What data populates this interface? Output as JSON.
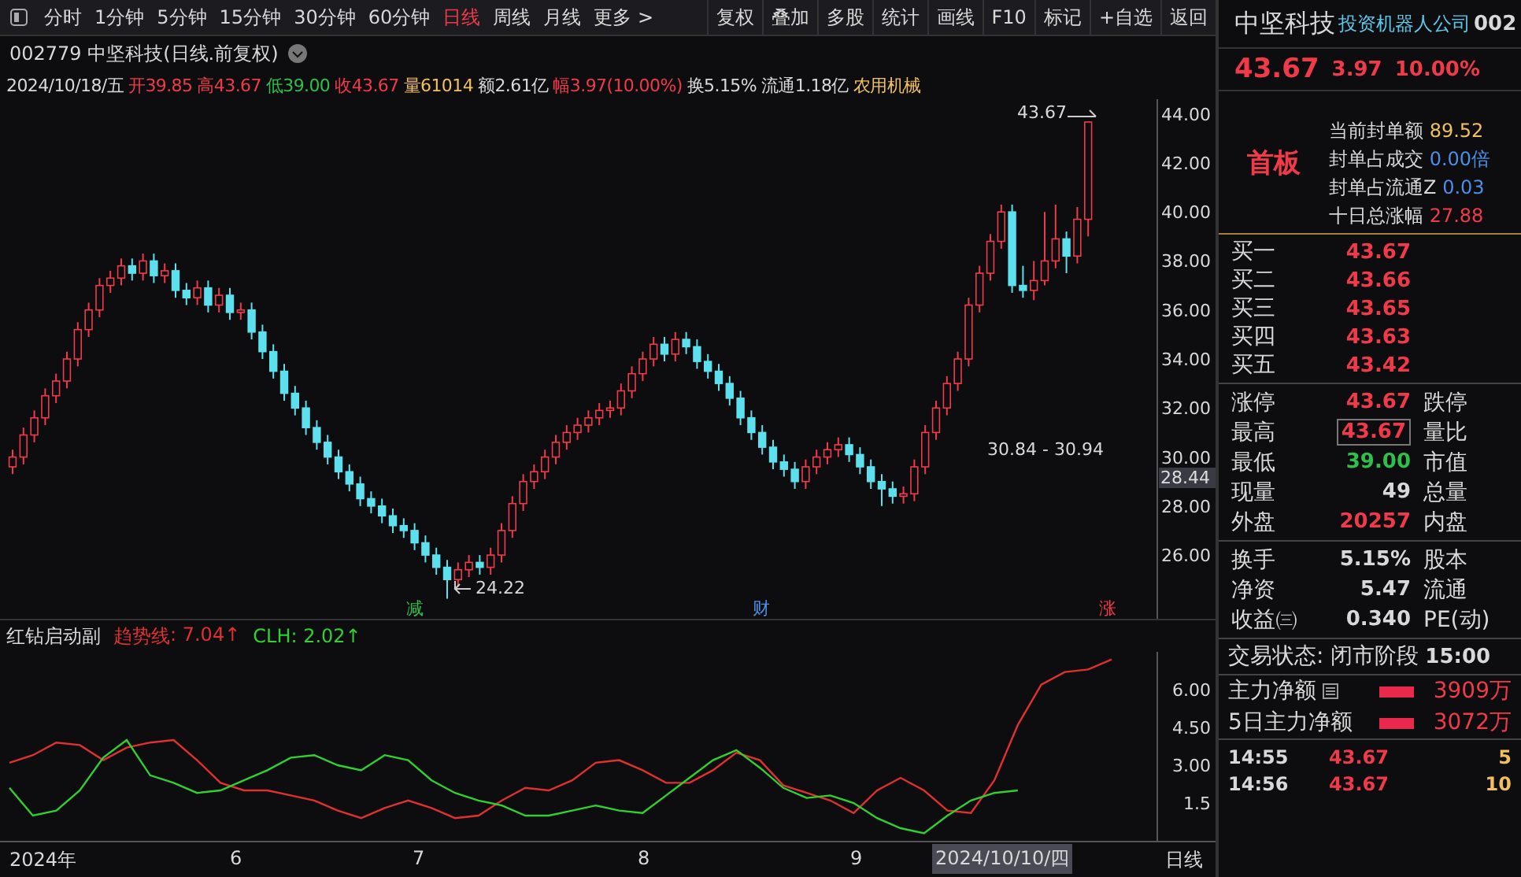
{
  "toolbar": {
    "periods": [
      {
        "label": "分时",
        "selected": false
      },
      {
        "label": "1分钟",
        "selected": false
      },
      {
        "label": "5分钟",
        "selected": false
      },
      {
        "label": "15分钟",
        "selected": false
      },
      {
        "label": "30分钟",
        "selected": false
      },
      {
        "label": "60分钟",
        "selected": false
      },
      {
        "label": "日线",
        "selected": true
      },
      {
        "label": "周线",
        "selected": false
      },
      {
        "label": "月线",
        "selected": false
      }
    ],
    "more": "更多 >",
    "actions": [
      "复权",
      "叠加",
      "多股",
      "统计",
      "画线",
      "F10",
      "标记",
      "+自选",
      "返回"
    ]
  },
  "header": {
    "title": "002779 中坚科技(日线.前复权)"
  },
  "quote_line": [
    {
      "text": "2024/10/18/五",
      "color": "#d8d8d8"
    },
    {
      "text": "开39.85",
      "color": "#f03a4a"
    },
    {
      "text": "高43.67",
      "color": "#f03a4a"
    },
    {
      "text": "低39.00",
      "color": "#2fbf4a"
    },
    {
      "text": "收43.67",
      "color": "#f03a4a"
    },
    {
      "text": "量61014",
      "color": "#f0c060"
    },
    {
      "text": "额2.61亿",
      "color": "#d8d8d8"
    },
    {
      "text": "幅3.97(10.00%)",
      "color": "#f03a4a"
    },
    {
      "text": "换5.15%",
      "color": "#d8d8d8"
    },
    {
      "text": "流通1.18亿",
      "color": "#d8d8d8"
    },
    {
      "text": "农用机械",
      "color": "#f0c060"
    }
  ],
  "chart": {
    "high_label": "43.67",
    "low_label": "24.22",
    "range_label": "30.84 - 30.94",
    "current_price": "28.44",
    "events": [
      {
        "text": "减",
        "color": "#2fbf4a"
      },
      {
        "text": "财",
        "color": "#4a90e8"
      },
      {
        "text": "涨",
        "color": "#f03a4a"
      }
    ],
    "chart_data": {
      "type": "candlestick",
      "ylim": [
        23.4,
        44.6
      ],
      "yticks": [
        {
          "value": 44,
          "label": "44.00"
        },
        {
          "value": 42,
          "label": "42.00"
        },
        {
          "value": 40,
          "label": "40.00"
        },
        {
          "value": 38,
          "label": "38.00"
        },
        {
          "value": 36,
          "label": "36.00"
        },
        {
          "value": 34,
          "label": "34.00"
        },
        {
          "value": 32,
          "label": "32.00"
        },
        {
          "value": 30,
          "label": "30.00"
        },
        {
          "value": 28,
          "label": "28.00"
        },
        {
          "value": 26,
          "label": "26.00"
        }
      ],
      "ohlc": [
        [
          29.6,
          30.3,
          29.3,
          30.0
        ],
        [
          30.0,
          31.2,
          29.7,
          30.9
        ],
        [
          30.9,
          31.9,
          30.6,
          31.6
        ],
        [
          31.6,
          32.8,
          31.3,
          32.5
        ],
        [
          32.5,
          33.4,
          32.2,
          33.1
        ],
        [
          33.1,
          34.3,
          32.8,
          34.0
        ],
        [
          34.0,
          35.5,
          33.7,
          35.2
        ],
        [
          35.2,
          36.3,
          34.9,
          36.0
        ],
        [
          36.0,
          37.3,
          35.7,
          37.0
        ],
        [
          37.0,
          37.6,
          36.7,
          37.3
        ],
        [
          37.3,
          38.1,
          37.0,
          37.8
        ],
        [
          37.8,
          38.1,
          37.2,
          37.5
        ],
        [
          37.5,
          38.3,
          37.2,
          38.0
        ],
        [
          38.0,
          38.3,
          37.1,
          37.4
        ],
        [
          37.4,
          37.9,
          37.1,
          37.6
        ],
        [
          37.6,
          37.9,
          36.5,
          36.8
        ],
        [
          36.8,
          37.1,
          36.2,
          36.5
        ],
        [
          36.5,
          37.2,
          36.2,
          36.9
        ],
        [
          36.9,
          37.2,
          35.9,
          36.2
        ],
        [
          36.2,
          36.9,
          35.9,
          36.6
        ],
        [
          36.6,
          36.9,
          35.6,
          35.9
        ],
        [
          35.9,
          36.3,
          35.6,
          36.0
        ],
        [
          36.0,
          36.3,
          34.8,
          35.1
        ],
        [
          35.1,
          35.4,
          34.0,
          34.3
        ],
        [
          34.3,
          34.6,
          33.2,
          33.5
        ],
        [
          33.5,
          33.8,
          32.3,
          32.6
        ],
        [
          32.6,
          32.9,
          31.7,
          32.0
        ],
        [
          32.0,
          32.3,
          30.9,
          31.2
        ],
        [
          31.2,
          31.5,
          30.3,
          30.6
        ],
        [
          30.6,
          30.9,
          29.7,
          30.0
        ],
        [
          30.0,
          30.3,
          29.1,
          29.4
        ],
        [
          29.4,
          29.7,
          28.6,
          28.9
        ],
        [
          28.9,
          29.2,
          28.0,
          28.3
        ],
        [
          28.3,
          28.6,
          27.7,
          28.0
        ],
        [
          28.0,
          28.3,
          27.3,
          27.6
        ],
        [
          27.6,
          27.9,
          26.9,
          27.2
        ],
        [
          27.2,
          27.5,
          26.7,
          27.0
        ],
        [
          27.0,
          27.3,
          26.2,
          26.5
        ],
        [
          26.5,
          26.8,
          25.7,
          26.0
        ],
        [
          26.0,
          26.3,
          25.2,
          25.5
        ],
        [
          25.5,
          25.8,
          24.22,
          25.0
        ],
        [
          25.0,
          25.7,
          24.7,
          25.4
        ],
        [
          25.4,
          26.0,
          25.1,
          25.7
        ],
        [
          25.7,
          26.0,
          25.2,
          25.5
        ],
        [
          25.5,
          26.3,
          25.2,
          26.0
        ],
        [
          26.0,
          27.3,
          25.7,
          27.0
        ],
        [
          27.0,
          28.4,
          26.7,
          28.1
        ],
        [
          28.1,
          29.3,
          27.8,
          29.0
        ],
        [
          29.0,
          29.7,
          28.7,
          29.4
        ],
        [
          29.4,
          30.3,
          29.1,
          30.0
        ],
        [
          30.0,
          30.9,
          29.7,
          30.6
        ],
        [
          30.6,
          31.3,
          30.3,
          31.0
        ],
        [
          31.0,
          31.6,
          30.7,
          31.3
        ],
        [
          31.3,
          31.9,
          31.0,
          31.6
        ],
        [
          31.6,
          32.2,
          31.3,
          31.9
        ],
        [
          31.9,
          32.3,
          31.6,
          32.0
        ],
        [
          32.0,
          33.0,
          31.7,
          32.7
        ],
        [
          32.7,
          33.7,
          32.4,
          33.4
        ],
        [
          33.4,
          34.3,
          33.1,
          34.0
        ],
        [
          34.0,
          34.9,
          33.7,
          34.6
        ],
        [
          34.6,
          34.9,
          33.9,
          34.2
        ],
        [
          34.2,
          35.1,
          33.9,
          34.8
        ],
        [
          34.8,
          35.1,
          34.2,
          34.5
        ],
        [
          34.5,
          34.8,
          33.6,
          33.9
        ],
        [
          33.9,
          34.2,
          33.2,
          33.5
        ],
        [
          33.5,
          33.8,
          32.7,
          33.0
        ],
        [
          33.0,
          33.3,
          32.1,
          32.4
        ],
        [
          32.4,
          32.7,
          31.3,
          31.6
        ],
        [
          31.6,
          31.9,
          30.7,
          31.0
        ],
        [
          31.0,
          31.3,
          30.1,
          30.4
        ],
        [
          30.4,
          30.7,
          29.5,
          29.8
        ],
        [
          29.8,
          30.1,
          29.2,
          29.5
        ],
        [
          29.5,
          29.8,
          28.7,
          29.0
        ],
        [
          29.0,
          29.9,
          28.7,
          29.6
        ],
        [
          29.6,
          30.3,
          29.3,
          30.0
        ],
        [
          30.0,
          30.6,
          29.7,
          30.3
        ],
        [
          30.3,
          30.8,
          30.0,
          30.5
        ],
        [
          30.5,
          30.8,
          29.8,
          30.1
        ],
        [
          30.1,
          30.4,
          29.3,
          29.6
        ],
        [
          29.6,
          29.9,
          28.7,
          29.0
        ],
        [
          29.0,
          29.3,
          28.0,
          28.7
        ],
        [
          28.7,
          29.0,
          28.1,
          28.4
        ],
        [
          28.4,
          28.8,
          28.1,
          28.5
        ],
        [
          28.5,
          29.9,
          28.2,
          29.6
        ],
        [
          29.6,
          31.3,
          29.3,
          31.0
        ],
        [
          31.0,
          32.3,
          30.7,
          32.0
        ],
        [
          32.0,
          33.3,
          31.7,
          33.0
        ],
        [
          33.0,
          34.3,
          32.7,
          34.0
        ],
        [
          34.0,
          36.5,
          33.7,
          36.2
        ],
        [
          36.2,
          37.8,
          35.9,
          37.5
        ],
        [
          37.5,
          39.1,
          37.2,
          38.8
        ],
        [
          38.8,
          40.3,
          38.5,
          40.0
        ],
        [
          40.0,
          40.3,
          36.7,
          37.0
        ],
        [
          37.0,
          37.8,
          36.5,
          36.8
        ],
        [
          36.8,
          38.0,
          36.4,
          37.2
        ],
        [
          37.2,
          40.0,
          37.0,
          38.0
        ],
        [
          38.0,
          40.3,
          37.7,
          38.9
        ],
        [
          38.9,
          39.2,
          37.5,
          38.2
        ],
        [
          38.2,
          40.2,
          37.9,
          39.7
        ],
        [
          39.7,
          43.67,
          39.0,
          43.67
        ]
      ]
    }
  },
  "indicator": {
    "name": "红钻启动副",
    "readouts": [
      ": 7.04↑",
      ": 2.02↑"
    ],
    "chart_data": {
      "type": "line",
      "ylim": [
        0,
        7.5
      ],
      "yticks": [
        {
          "value": 6,
          "label": "6.00"
        },
        {
          "value": 4.5,
          "label": "4.50"
        },
        {
          "value": 3,
          "label": "3.00"
        },
        {
          "value": 1.5,
          "label": "1.5"
        }
      ],
      "series": [
        {
          "name": "趋势线",
          "color": "#e03030",
          "values": [
            3.1,
            3.4,
            3.9,
            3.8,
            3.2,
            3.7,
            3.9,
            4.0,
            3.2,
            2.3,
            2.0,
            2.0,
            1.8,
            1.6,
            1.2,
            0.9,
            1.3,
            1.6,
            1.3,
            0.9,
            1.0,
            1.6,
            2.1,
            2.0,
            2.4,
            3.1,
            3.2,
            2.8,
            2.3,
            2.3,
            2.8,
            3.5,
            3.2,
            2.2,
            1.9,
            1.6,
            1.1,
            2.0,
            2.5,
            2.0,
            1.2,
            1.1,
            2.4,
            4.6,
            6.2,
            6.7,
            6.8,
            7.2
          ]
        },
        {
          "name": "CLH",
          "color": "#30d030",
          "values": [
            2.1,
            1.0,
            1.2,
            2.0,
            3.3,
            4.0,
            2.6,
            2.3,
            1.9,
            2.0,
            2.4,
            2.8,
            3.3,
            3.4,
            3.0,
            2.8,
            3.4,
            3.2,
            2.4,
            1.9,
            1.6,
            1.4,
            1.0,
            1.0,
            1.2,
            1.4,
            1.2,
            1.1,
            1.8,
            2.5,
            3.2,
            3.6,
            2.9,
            2.1,
            1.7,
            1.8,
            1.5,
            0.9,
            0.5,
            0.3,
            1.0,
            1.6,
            1.9,
            2.0,
            null,
            null,
            null,
            null
          ]
        }
      ]
    }
  },
  "date_axis": {
    "labels": [
      "2024年",
      "6",
      "7",
      "8",
      "9"
    ],
    "cursor_date": "2024/10/10/四",
    "period": "日线"
  },
  "panel": {
    "name": "中坚科技",
    "tag": "投资机器人公司",
    "code": "002",
    "price": "43.67",
    "change": "3.97",
    "pct": "10.00%",
    "badge": "首板",
    "seal": [
      {
        "label": "当前封单额",
        "value": "89.52",
        "color": "#f0c060"
      },
      {
        "label": "封单占成交",
        "value": "0.00倍",
        "color": "#4a90e8"
      },
      {
        "label": "封单占流通Z",
        "value": "0.03",
        "color": "#4a90e8"
      },
      {
        "label": "十日总涨幅",
        "value": "27.88",
        "color": "#f03a4a"
      }
    ],
    "book": [
      {
        "label": "买一",
        "price": "43.67"
      },
      {
        "label": "买二",
        "price": "43.66"
      },
      {
        "label": "买三",
        "price": "43.65"
      },
      {
        "label": "买四",
        "price": "43.63"
      },
      {
        "label": "买五",
        "price": "43.42"
      }
    ],
    "stats": [
      {
        "label": "涨停",
        "value": "43.67",
        "color": "#f03a4a",
        "label2": "跌停",
        "boxed": false
      },
      {
        "label": "最高",
        "value": "43.67",
        "color": "#f03a4a",
        "label2": "量比",
        "boxed": true
      },
      {
        "label": "最低",
        "value": "39.00",
        "color": "#2fbf4a",
        "label2": "市值",
        "boxed": false
      },
      {
        "label": "现量",
        "value": "49",
        "color": "#d8d8d8",
        "label2": "总量",
        "boxed": false
      },
      {
        "label": "外盘",
        "value": "20257",
        "color": "#f03a4a",
        "label2": "内盘",
        "boxed": false
      }
    ],
    "stats2": [
      {
        "label": "换手",
        "value": "5.15%",
        "label2": "股本"
      },
      {
        "label": "净资",
        "value": "5.47",
        "label2": "流通"
      },
      {
        "label": "收益㈢",
        "value": "0.340",
        "label2": "PE(动)"
      }
    ],
    "status_label": "交易状态: 闭市阶段",
    "status_time": "15:00",
    "flows": [
      {
        "label": "主力净额",
        "value": "3909万",
        "icon": true
      },
      {
        "label": "5日主力净额",
        "value": "3072万",
        "icon": false
      }
    ],
    "ticks": [
      {
        "time": "14:55",
        "price": "43.67",
        "volume": "5"
      },
      {
        "time": "14:56",
        "price": "43.67",
        "volume": "10"
      }
    ]
  }
}
